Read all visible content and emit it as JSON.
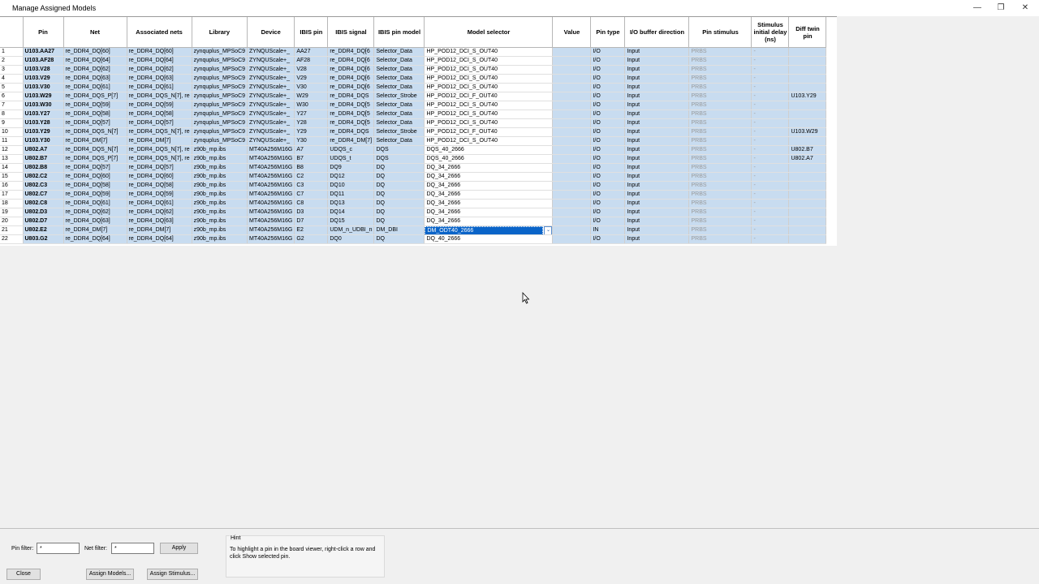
{
  "window": {
    "title": "Manage Assigned Models"
  },
  "columns": [
    "",
    "Pin",
    "Net",
    "Associated nets",
    "Library",
    "Device",
    "IBIS pin",
    "IBIS signal",
    "IBIS pin model",
    "Model selector",
    "Value",
    "Pin type",
    "I/O buffer direction",
    "Pin stimulus",
    "Stimulus initial delay (ns)",
    "Diff twin pin"
  ],
  "rows": [
    {
      "n": "1",
      "pin": "U103.AA27",
      "net": "re_DDR4_DQ[60]",
      "assoc": "re_DDR4_DQ[60]",
      "lib": "zynquplus_MPSoC9",
      "dev": "ZYNQUScale+_",
      "ibispin": "AA27",
      "ibissig": "re_DDR4_DQ[6",
      "model": "Selector_Data",
      "sel": "HP_POD12_DCI_S_OUT40",
      "val": "",
      "ptype": "I/O",
      "dir": "Input",
      "stim": "PRBS",
      "delay": "-",
      "twin": ""
    },
    {
      "n": "2",
      "pin": "U103.AF28",
      "net": "re_DDR4_DQ[64]",
      "assoc": "re_DDR4_DQ[64]",
      "lib": "zynquplus_MPSoC9",
      "dev": "ZYNQUScale+_",
      "ibispin": "AF28",
      "ibissig": "re_DDR4_DQ[6",
      "model": "Selector_Data",
      "sel": "HP_POD12_DCI_S_OUT40",
      "val": "",
      "ptype": "I/O",
      "dir": "Input",
      "stim": "PRBS",
      "delay": "-",
      "twin": ""
    },
    {
      "n": "3",
      "pin": "U103.V28",
      "net": "re_DDR4_DQ[62]",
      "assoc": "re_DDR4_DQ[62]",
      "lib": "zynquplus_MPSoC9",
      "dev": "ZYNQUScale+_",
      "ibispin": "V28",
      "ibissig": "re_DDR4_DQ[6",
      "model": "Selector_Data",
      "sel": "HP_POD12_DCI_S_OUT40",
      "val": "",
      "ptype": "I/O",
      "dir": "Input",
      "stim": "PRBS",
      "delay": "-",
      "twin": ""
    },
    {
      "n": "4",
      "pin": "U103.V29",
      "net": "re_DDR4_DQ[63]",
      "assoc": "re_DDR4_DQ[63]",
      "lib": "zynquplus_MPSoC9",
      "dev": "ZYNQUScale+_",
      "ibispin": "V29",
      "ibissig": "re_DDR4_DQ[6",
      "model": "Selector_Data",
      "sel": "HP_POD12_DCI_S_OUT40",
      "val": "",
      "ptype": "I/O",
      "dir": "Input",
      "stim": "PRBS",
      "delay": "-",
      "twin": ""
    },
    {
      "n": "5",
      "pin": "U103.V30",
      "net": "re_DDR4_DQ[61]",
      "assoc": "re_DDR4_DQ[61]",
      "lib": "zynquplus_MPSoC9",
      "dev": "ZYNQUScale+_",
      "ibispin": "V30",
      "ibissig": "re_DDR4_DQ[6",
      "model": "Selector_Data",
      "sel": "HP_POD12_DCI_S_OUT40",
      "val": "",
      "ptype": "I/O",
      "dir": "Input",
      "stim": "PRBS",
      "delay": "-",
      "twin": ""
    },
    {
      "n": "6",
      "pin": "U103.W29",
      "net": "re_DDR4_DQS_P[7]",
      "assoc": "re_DDR4_DQS_N[7], re",
      "lib": "zynquplus_MPSoC9",
      "dev": "ZYNQUScale+_",
      "ibispin": "W29",
      "ibissig": "re_DDR4_DQS",
      "model": "Selector_Strobe",
      "sel": "HP_POD12_DCI_F_OUT40",
      "val": "",
      "ptype": "I/O",
      "dir": "Input",
      "stim": "PRBS",
      "delay": "-",
      "twin": "U103.Y29"
    },
    {
      "n": "7",
      "pin": "U103.W30",
      "net": "re_DDR4_DQ[59]",
      "assoc": "re_DDR4_DQ[59]",
      "lib": "zynquplus_MPSoC9",
      "dev": "ZYNQUScale+_",
      "ibispin": "W30",
      "ibissig": "re_DDR4_DQ[5",
      "model": "Selector_Data",
      "sel": "HP_POD12_DCI_S_OUT40",
      "val": "",
      "ptype": "I/O",
      "dir": "Input",
      "stim": "PRBS",
      "delay": "-",
      "twin": ""
    },
    {
      "n": "8",
      "pin": "U103.Y27",
      "net": "re_DDR4_DQ[58]",
      "assoc": "re_DDR4_DQ[58]",
      "lib": "zynquplus_MPSoC9",
      "dev": "ZYNQUScale+_",
      "ibispin": "Y27",
      "ibissig": "re_DDR4_DQ[5",
      "model": "Selector_Data",
      "sel": "HP_POD12_DCI_S_OUT40",
      "val": "",
      "ptype": "I/O",
      "dir": "Input",
      "stim": "PRBS",
      "delay": "-",
      "twin": ""
    },
    {
      "n": "9",
      "pin": "U103.Y28",
      "net": "re_DDR4_DQ[57]",
      "assoc": "re_DDR4_DQ[57]",
      "lib": "zynquplus_MPSoC9",
      "dev": "ZYNQUScale+_",
      "ibispin": "Y28",
      "ibissig": "re_DDR4_DQ[5",
      "model": "Selector_Data",
      "sel": "HP_POD12_DCI_S_OUT40",
      "val": "",
      "ptype": "I/O",
      "dir": "Input",
      "stim": "PRBS",
      "delay": "-",
      "twin": ""
    },
    {
      "n": "10",
      "pin": "U103.Y29",
      "net": "re_DDR4_DQS_N[7]",
      "assoc": "re_DDR4_DQS_N[7], re",
      "lib": "zynquplus_MPSoC9",
      "dev": "ZYNQUScale+_",
      "ibispin": "Y29",
      "ibissig": "re_DDR4_DQS",
      "model": "Selector_Strobe",
      "sel": "HP_POD12_DCI_F_OUT40",
      "val": "",
      "ptype": "I/O",
      "dir": "Input",
      "stim": "PRBS",
      "delay": "-",
      "twin": "U103.W29"
    },
    {
      "n": "11",
      "pin": "U103.Y30",
      "net": "re_DDR4_DM[7]",
      "assoc": "re_DDR4_DM[7]",
      "lib": "zynquplus_MPSoC9",
      "dev": "ZYNQUScale+_",
      "ibispin": "Y30",
      "ibissig": "re_DDR4_DM[7]",
      "model": "Selector_Data",
      "sel": "HP_POD12_DCI_S_OUT40",
      "val": "",
      "ptype": "I/O",
      "dir": "Input",
      "stim": "PRBS",
      "delay": "-",
      "twin": ""
    },
    {
      "n": "12",
      "pin": "U802.A7",
      "net": "re_DDR4_DQS_N[7]",
      "assoc": "re_DDR4_DQS_N[7], re",
      "lib": "z90b_mp.ibs",
      "dev": "MT40A256M16G",
      "ibispin": "A7",
      "ibissig": "UDQS_c",
      "model": "DQS",
      "sel": "DQS_40_2666",
      "val": "",
      "ptype": "I/O",
      "dir": "Input",
      "stim": "PRBS",
      "delay": "-",
      "twin": "U802.B7"
    },
    {
      "n": "13",
      "pin": "U802.B7",
      "net": "re_DDR4_DQS_P[7]",
      "assoc": "re_DDR4_DQS_N[7], re",
      "lib": "z90b_mp.ibs",
      "dev": "MT40A256M16G",
      "ibispin": "B7",
      "ibissig": "UDQS_t",
      "model": "DQS",
      "sel": "DQS_40_2666",
      "val": "",
      "ptype": "I/O",
      "dir": "Input",
      "stim": "PRBS",
      "delay": "-",
      "twin": "U802.A7"
    },
    {
      "n": "14",
      "pin": "U802.B8",
      "net": "re_DDR4_DQ[57]",
      "assoc": "re_DDR4_DQ[57]",
      "lib": "z90b_mp.ibs",
      "dev": "MT40A256M16G",
      "ibispin": "B8",
      "ibissig": "DQ9",
      "model": "DQ",
      "sel": "DQ_34_2666",
      "val": "",
      "ptype": "I/O",
      "dir": "Input",
      "stim": "PRBS",
      "delay": "-",
      "twin": ""
    },
    {
      "n": "15",
      "pin": "U802.C2",
      "net": "re_DDR4_DQ[60]",
      "assoc": "re_DDR4_DQ[60]",
      "lib": "z90b_mp.ibs",
      "dev": "MT40A256M16G",
      "ibispin": "C2",
      "ibissig": "DQ12",
      "model": "DQ",
      "sel": "DQ_34_2666",
      "val": "",
      "ptype": "I/O",
      "dir": "Input",
      "stim": "PRBS",
      "delay": "-",
      "twin": ""
    },
    {
      "n": "16",
      "pin": "U802.C3",
      "net": "re_DDR4_DQ[58]",
      "assoc": "re_DDR4_DQ[58]",
      "lib": "z90b_mp.ibs",
      "dev": "MT40A256M16G",
      "ibispin": "C3",
      "ibissig": "DQ10",
      "model": "DQ",
      "sel": "DQ_34_2666",
      "val": "",
      "ptype": "I/O",
      "dir": "Input",
      "stim": "PRBS",
      "delay": "-",
      "twin": ""
    },
    {
      "n": "17",
      "pin": "U802.C7",
      "net": "re_DDR4_DQ[59]",
      "assoc": "re_DDR4_DQ[59]",
      "lib": "z90b_mp.ibs",
      "dev": "MT40A256M16G",
      "ibispin": "C7",
      "ibissig": "DQ11",
      "model": "DQ",
      "sel": "DQ_34_2666",
      "val": "",
      "ptype": "I/O",
      "dir": "Input",
      "stim": "PRBS",
      "delay": "-",
      "twin": ""
    },
    {
      "n": "18",
      "pin": "U802.C8",
      "net": "re_DDR4_DQ[61]",
      "assoc": "re_DDR4_DQ[61]",
      "lib": "z90b_mp.ibs",
      "dev": "MT40A256M16G",
      "ibispin": "C8",
      "ibissig": "DQ13",
      "model": "DQ",
      "sel": "DQ_34_2666",
      "val": "",
      "ptype": "I/O",
      "dir": "Input",
      "stim": "PRBS",
      "delay": "-",
      "twin": ""
    },
    {
      "n": "19",
      "pin": "U802.D3",
      "net": "re_DDR4_DQ[62]",
      "assoc": "re_DDR4_DQ[62]",
      "lib": "z90b_mp.ibs",
      "dev": "MT40A256M16G",
      "ibispin": "D3",
      "ibissig": "DQ14",
      "model": "DQ",
      "sel": "DQ_34_2666",
      "val": "",
      "ptype": "I/O",
      "dir": "Input",
      "stim": "PRBS",
      "delay": "-",
      "twin": ""
    },
    {
      "n": "20",
      "pin": "U802.D7",
      "net": "re_DDR4_DQ[63]",
      "assoc": "re_DDR4_DQ[63]",
      "lib": "z90b_mp.ibs",
      "dev": "MT40A256M16G",
      "ibispin": "D7",
      "ibissig": "DQ15",
      "model": "DQ",
      "sel": "DQ_34_2666",
      "val": "",
      "ptype": "I/O",
      "dir": "Input",
      "stim": "PRBS",
      "delay": "-",
      "twin": ""
    },
    {
      "n": "21",
      "pin": "U802.E2",
      "net": "re_DDR4_DM[7]",
      "assoc": "re_DDR4_DM[7]",
      "lib": "z90b_mp.ibs",
      "dev": "MT40A256M16G",
      "ibispin": "E2",
      "ibissig": "UDM_n_UDBI_n",
      "model": "DM_DBI",
      "sel": "DM_ODT40_2666",
      "val": "",
      "ptype": "IN",
      "dir": "Input",
      "stim": "PRBS",
      "delay": "-",
      "twin": "",
      "editing": true
    },
    {
      "n": "22",
      "pin": "U803.G2",
      "net": "re_DDR4_DQ[64]",
      "assoc": "re_DDR4_DQ[64]",
      "lib": "z90b_mp.ibs",
      "dev": "MT40A256M16G",
      "ibispin": "G2",
      "ibissig": "DQ0",
      "model": "DQ",
      "sel": "DQ_40_2666",
      "val": "",
      "ptype": "I/O",
      "dir": "Input",
      "stim": "PRBS",
      "delay": "-",
      "twin": ""
    }
  ],
  "filters": {
    "pin_label": "Pin filter:",
    "pin_value": "*",
    "net_label": "Net filter:",
    "net_value": "*",
    "apply_label": "Apply"
  },
  "hint": {
    "title": "Hint",
    "text": "To highlight a pin in the board viewer, right-click a row and click Show selected pin."
  },
  "buttons": {
    "close": "Close",
    "assign_models": "Assign Models...",
    "assign_stimulus": "Assign Stimulus..."
  },
  "icons": {
    "minimize": "minimize-icon",
    "restore": "restore-icon",
    "close": "close-icon",
    "dropdown": "chevron-down-icon",
    "cursor": "mouse-pointer-icon"
  }
}
